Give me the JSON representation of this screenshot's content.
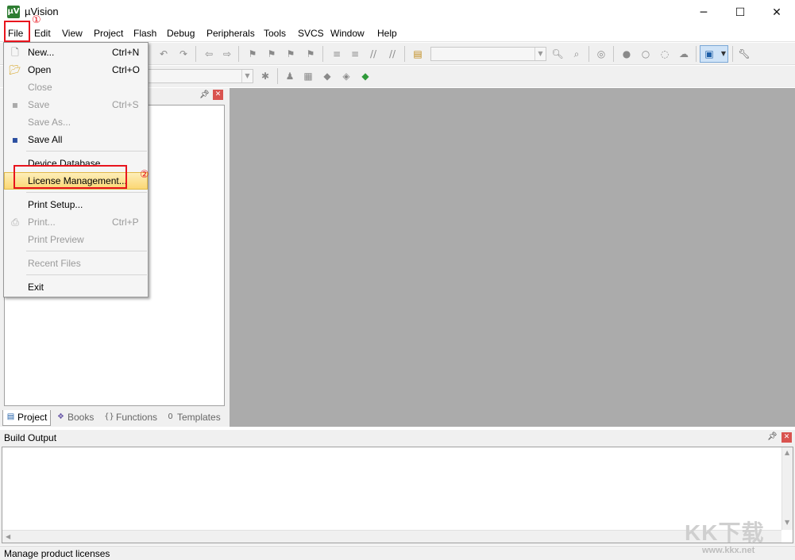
{
  "window": {
    "title": "µVision",
    "minimize_icon": "minimize-icon",
    "maximize_icon": "maximize-icon",
    "close_icon": "close-icon"
  },
  "menubar": [
    "File",
    "Edit",
    "View",
    "Project",
    "Flash",
    "Debug",
    "Peripherals",
    "Tools",
    "SVCS",
    "Window",
    "Help"
  ],
  "file_menu": {
    "items": [
      {
        "label": "New...",
        "shortcut": "Ctrl+N",
        "enabled": true,
        "icon": "new-file-icon"
      },
      {
        "label": "Open",
        "shortcut": "Ctrl+O",
        "enabled": true,
        "icon": "open-folder-icon"
      },
      {
        "label": "Close",
        "shortcut": "",
        "enabled": false,
        "icon": ""
      },
      {
        "label": "Save",
        "shortcut": "Ctrl+S",
        "enabled": false,
        "icon": "save-icon"
      },
      {
        "label": "Save As...",
        "shortcut": "",
        "enabled": false,
        "icon": ""
      },
      {
        "label": "Save All",
        "shortcut": "",
        "enabled": true,
        "icon": "save-all-icon"
      },
      {
        "label": "Device Database",
        "shortcut": "",
        "enabled": true,
        "icon": ""
      },
      {
        "label": "License Management...",
        "shortcut": "",
        "enabled": true,
        "icon": "",
        "highlighted": true
      },
      {
        "label": "Print Setup...",
        "shortcut": "",
        "enabled": true,
        "icon": ""
      },
      {
        "label": "Print...",
        "shortcut": "Ctrl+P",
        "enabled": false,
        "icon": "print-icon"
      },
      {
        "label": "Print Preview",
        "shortcut": "",
        "enabled": false,
        "icon": ""
      },
      {
        "label": "Recent Files",
        "shortcut": "",
        "enabled": false,
        "icon": ""
      },
      {
        "label": "Exit",
        "shortcut": "",
        "enabled": true,
        "icon": ""
      }
    ]
  },
  "annotations": {
    "step1": "①",
    "step2": "②",
    "color": "#e8141d"
  },
  "project_panel": {
    "tabs": [
      {
        "label": "Project",
        "icon": "project-icon",
        "active": true
      },
      {
        "label": "Books",
        "icon": "books-icon",
        "active": false
      },
      {
        "label": "Functions",
        "icon": "functions-icon",
        "active": false
      },
      {
        "label": "Templates",
        "icon": "templates-icon",
        "active": false
      }
    ],
    "pin_glyph": "ᵖ",
    "close_glyph": "x"
  },
  "build_output": {
    "title": "Build Output"
  },
  "status_bar": {
    "text": "Manage product licenses"
  },
  "watermark": {
    "big": "KK下载",
    "small": "www.kkx.net"
  },
  "colors": {
    "workspace": "#ababab",
    "highlight": "#fbd774",
    "annotation": "#e8141d"
  }
}
